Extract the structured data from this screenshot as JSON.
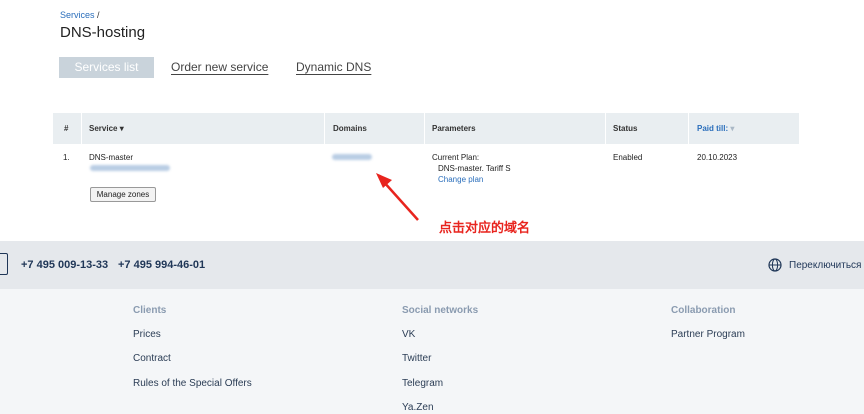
{
  "breadcrumb": {
    "services": "Services",
    "separator": " /"
  },
  "page_title": "DNS-hosting",
  "tabs": {
    "services_list": "Services list",
    "order_new": "Order new service",
    "dynamic_dns": "Dynamic DNS"
  },
  "table": {
    "headers": {
      "num": "#",
      "service": "Service ▾",
      "domains": "Domains",
      "parameters": "Parameters",
      "status": "Status",
      "paid_till": "Paid till:",
      "paid_till_sort": "▾"
    },
    "row": {
      "num": "1.",
      "service": "DNS-master",
      "current_plan_label": "Current Plan:",
      "plan": "DNS-master. Tariff S",
      "change_plan": "Change plan",
      "status": "Enabled",
      "paid_till": "20.10.2023",
      "manage_zones": "Manage zones"
    }
  },
  "annotation": "点击对应的域名",
  "footer": {
    "phone1": "+7 495 009-13-33",
    "phone2": "+7 495 994-46-01",
    "language_switch": "Переключиться",
    "clients": {
      "heading": "Clients",
      "links": [
        "Prices",
        "Contract",
        "Rules of the Special Offers"
      ]
    },
    "social": {
      "heading": "Social networks",
      "links": [
        "VK",
        "Twitter",
        "Telegram",
        "Ya.Zen"
      ]
    },
    "collaboration": {
      "heading": "Collaboration",
      "links": [
        "Partner Program"
      ]
    }
  },
  "colors": {
    "accent": "#2a6ebb",
    "annotation": "#e8241e",
    "footer_text": "#1f3657"
  },
  "icons": [
    "arrow-annotation-icon",
    "globe-icon",
    "sort-down-icon"
  ]
}
